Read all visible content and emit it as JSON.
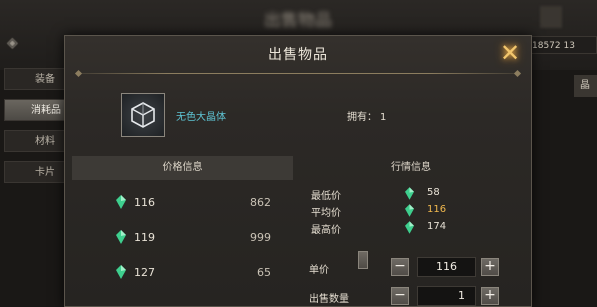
{
  "background": {
    "title": "出售物品",
    "currency": "18572 13",
    "right_button": "晶",
    "side_tabs": [
      "装备",
      "消耗品",
      "材料",
      "卡片"
    ]
  },
  "dialog": {
    "title": "出售物品",
    "close_icon": "close-x-icon",
    "item": {
      "name": "无色大晶体",
      "owned_label": "拥有：",
      "owned_count": "1",
      "icon": "crystal-cube-icon"
    },
    "price_section": {
      "title": "价格信息",
      "rows": [
        {
          "price": "116",
          "qty": "862"
        },
        {
          "price": "119",
          "qty": "999"
        },
        {
          "price": "127",
          "qty": "65"
        }
      ]
    },
    "market_section": {
      "title": "行情信息",
      "min_label": "最低价",
      "min_value": "58",
      "avg_label": "平均价",
      "avg_value": "116",
      "max_label": "最高价",
      "max_value": "174"
    },
    "unit_price": {
      "label": "单价",
      "value": "116",
      "minus": "−",
      "plus": "+"
    },
    "sell_quantity": {
      "label": "出售数量",
      "value": "1",
      "minus": "−",
      "plus": "+"
    }
  },
  "colors": {
    "accent_gold": "#f0b84e",
    "item_name": "#5fc6d6",
    "gem_green": "#3ecf8e"
  }
}
